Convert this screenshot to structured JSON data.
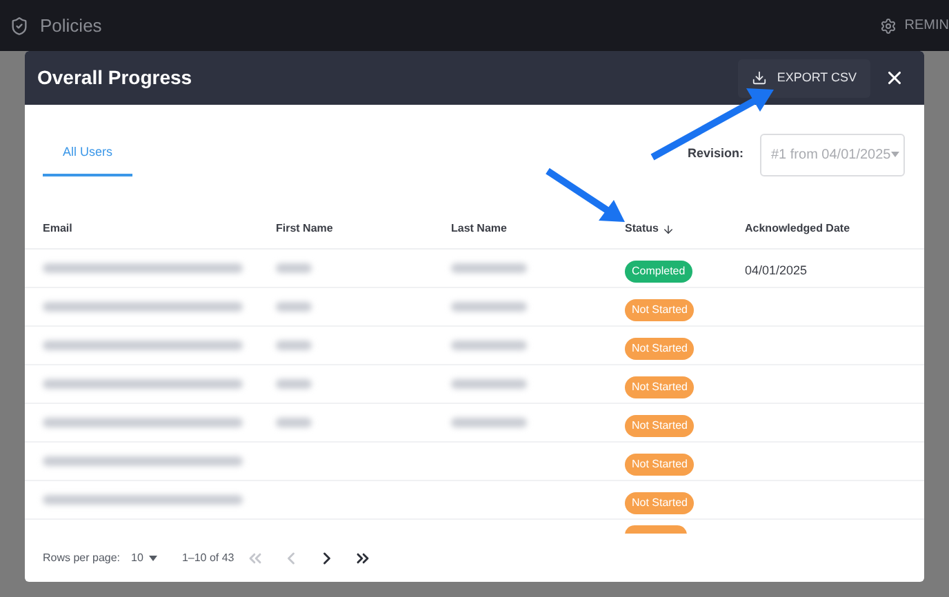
{
  "app_bar": {
    "title": "Policies",
    "right_label": "REMIN"
  },
  "dialog": {
    "title": "Overall Progress",
    "export_button": "EXPORT CSV"
  },
  "tabs": [
    {
      "label": "All Users",
      "selected": true
    }
  ],
  "revision": {
    "label": "Revision:",
    "value": "#1 from 04/01/2025"
  },
  "table": {
    "columns": [
      {
        "label": "Email",
        "sorted": false
      },
      {
        "label": "First Name",
        "sorted": false
      },
      {
        "label": "Last Name",
        "sorted": false
      },
      {
        "label": "Status",
        "sorted": true
      },
      {
        "label": "Acknowledged Date",
        "sorted": false
      }
    ],
    "rows": [
      {
        "email_blurred": true,
        "names_blurred": true,
        "status": "Completed",
        "color": "#1fb471",
        "acknowledged_date": "04/01/2025"
      },
      {
        "email_blurred": true,
        "names_blurred": true,
        "status": "Not Started",
        "color": "#f7a04b"
      },
      {
        "email_blurred": true,
        "names_blurred": true,
        "status": "Not Started",
        "color": "#f7a04b"
      },
      {
        "email_blurred": true,
        "names_blurred": true,
        "status": "Not Started",
        "color": "#f7a04b"
      },
      {
        "email_blurred": true,
        "names_blurred": true,
        "status": "Not Started",
        "color": "#f7a04b"
      },
      {
        "email_blurred": true,
        "names_blurred": false,
        "status": "Not Started",
        "color": "#f7a04b"
      },
      {
        "email_blurred": true,
        "names_blurred": false,
        "status": "Not Started",
        "color": "#f7a04b"
      },
      {
        "email_blurred": false,
        "names_blurred": false,
        "color": "#f7a04b"
      }
    ]
  },
  "pagination": {
    "rows_per_page_label": "Rows per page:",
    "rows_per_page": "10",
    "range": "1–10 of 43",
    "first_disabled": true,
    "prev_disabled": true,
    "next_disabled": false,
    "last_disabled": false
  }
}
